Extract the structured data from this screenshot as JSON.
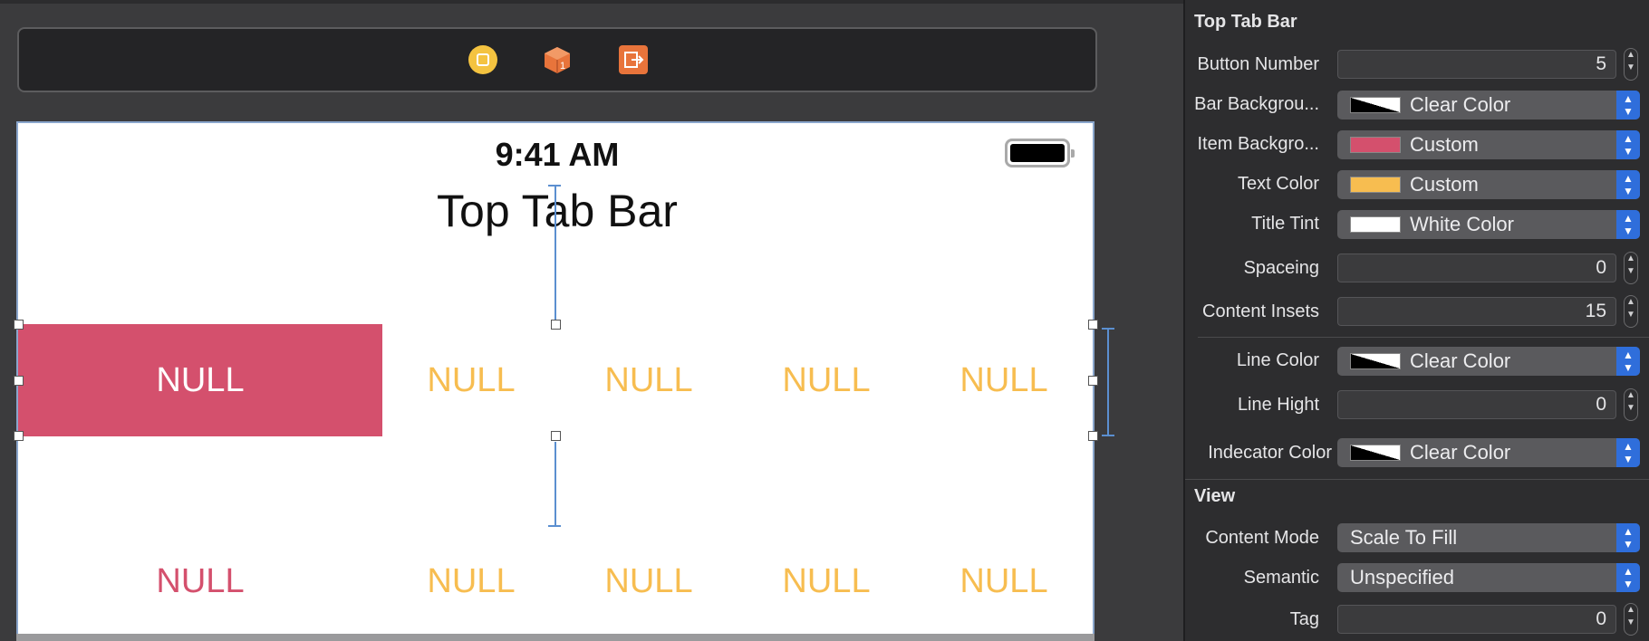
{
  "canvas": {
    "status_time": "9:41 AM",
    "nav_title": "Top Tab Bar",
    "tabs": [
      "NULL",
      "NULL",
      "NULL",
      "NULL",
      "NULL"
    ],
    "tabs_bottom": [
      "NULL",
      "NULL",
      "NULL",
      "NULL",
      "NULL"
    ]
  },
  "inspector": {
    "section_top_tab_bar": "Top Tab Bar",
    "button_number": {
      "label": "Button Number",
      "value": "5"
    },
    "bar_background": {
      "label": "Bar Backgrou...",
      "value": "Clear Color"
    },
    "item_background": {
      "label": "Item Backgro...",
      "value": "Custom",
      "swatch": "#d4506d"
    },
    "text_color": {
      "label": "Text Color",
      "value": "Custom",
      "swatch": "#f7bd50"
    },
    "title_tint": {
      "label": "Title Tint",
      "value": "White Color",
      "swatch": "#ffffff"
    },
    "spaceing": {
      "label": "Spaceing",
      "value": "0"
    },
    "content_insets": {
      "label": "Content Insets",
      "value": "15"
    },
    "line_color": {
      "label": "Line Color",
      "value": "Clear Color"
    },
    "line_hight": {
      "label": "Line Hight",
      "value": "0"
    },
    "indecator_color": {
      "label": "Indecator Color",
      "value": "Clear Color"
    },
    "section_view": "View",
    "content_mode": {
      "label": "Content Mode",
      "value": "Scale To Fill"
    },
    "semantic": {
      "label": "Semantic",
      "value": "Unspecified"
    },
    "tag": {
      "label": "Tag",
      "value": "0"
    }
  },
  "colors": {
    "selected_item_background": "#d4506d",
    "tab_text": "#f7bd50",
    "accent": "#2f6edb"
  }
}
